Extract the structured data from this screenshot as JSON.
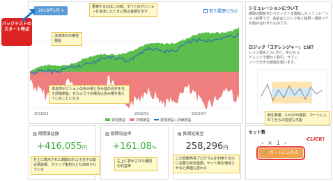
{
  "annotation": {
    "backtest_start": "バックテストのスタート時点",
    "click_label": "CLICK!"
  },
  "chart_panel": {
    "date_button": "2018年1月",
    "export_link": "取引履歴(CSV)",
    "legend": [
      "実現損益",
      "評価損益",
      "実現損益+評価損益"
    ],
    "x_ticks": [
      "2018/01",
      "2019/01",
      "2019/07"
    ],
    "colors": {
      "realized": "#5cbf4d",
      "unrealized": "#ef7f7f",
      "total": "#2a6fb8"
    }
  },
  "callouts": {
    "top_note": "重視するのはこの線。すべてのポジションを決済したときに残る金額を示す",
    "realized_note": "決済済みの実現損益",
    "unrealized_note": "未決済ポジションの含み損と含み益の合計を示す評価損益。ゼロより下の場合は含み損を抱えていることになる",
    "profit_note": "左上に表示された期間のおよそ右下の総合損益額、スワップ金利なども加味されている",
    "return_note": "左上に表示された期間の収益率",
    "margin_note": "この自動売買プログラムを利用するのに必要な目安金額。セット数を増減させると数値も変わる",
    "set_note": "取引数量…1=1000通貨。カートに入れてからの変更も可能"
  },
  "stats": [
    {
      "label": "期間損益額",
      "value": "+416,055",
      "unit": "円"
    },
    {
      "label": "期間収益率",
      "value": "+161.08",
      "unit": "%"
    },
    {
      "label": "推奨証拠金",
      "value": "258,296",
      "unit": "円"
    }
  ],
  "right_panel": {
    "title": "シミュレーションについて",
    "body": "期間の開始日からセレクトを開始したシミュレーション結果です。名前はロジック名と銘柄・通貨ペアを組み合わせたものです。",
    "logic_title": "ロジック「コアレンジャー」とは？",
    "logic_body": "レンジ幅を2つに分け、中心のコアレンジで細かく取引、サブレンジで大きな値幅を狙います。"
  },
  "order": {
    "set_label": "セット数",
    "quantity": "1",
    "cart_button": "カートに入れる"
  }
}
